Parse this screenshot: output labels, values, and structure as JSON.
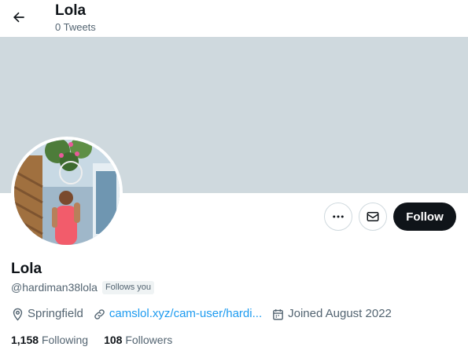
{
  "header": {
    "title": "Lola",
    "subtitle": "0 Tweets",
    "back_icon": "arrow-left-icon"
  },
  "colors": {
    "banner": "#cfd9de",
    "follow_button_bg": "#0f1419",
    "link": "#1d9bf0",
    "secondary_text": "#536471"
  },
  "actions": {
    "more_icon": "more-horizontal-icon",
    "message_icon": "envelope-icon",
    "follow_label": "Follow"
  },
  "profile": {
    "name": "Lola",
    "handle": "@hardiman38lola",
    "follows_you": "Follows you",
    "location": "Springfield",
    "website": "camslol.xyz/cam-user/hardi...",
    "joined": "Joined August 2022"
  },
  "stats": {
    "following_count": "1,158",
    "following_label": "Following",
    "followers_count": "108",
    "followers_label": "Followers"
  }
}
